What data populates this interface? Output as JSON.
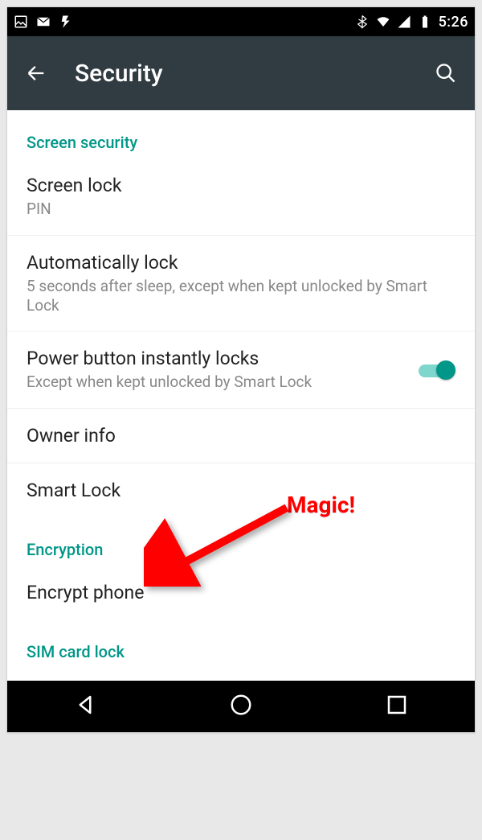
{
  "statusbar": {
    "time": "5:26"
  },
  "appbar": {
    "title": "Security"
  },
  "sections": {
    "screen_security": {
      "header": "Screen security",
      "screen_lock": {
        "title": "Screen lock",
        "value": "PIN"
      },
      "auto_lock": {
        "title": "Automatically lock",
        "value": "5 seconds after sleep, except when kept unlocked by Smart Lock"
      },
      "power_lock": {
        "title": "Power button instantly locks",
        "value": "Except when kept unlocked by Smart Lock",
        "toggle": true
      },
      "owner_info": {
        "title": "Owner info"
      },
      "smart_lock": {
        "title": "Smart Lock"
      }
    },
    "encryption": {
      "header": "Encryption",
      "encrypt_phone": {
        "title": "Encrypt phone"
      }
    },
    "sim": {
      "header": "SIM card lock"
    }
  },
  "annotation": {
    "label": "Magic!"
  },
  "colors": {
    "accent": "#009688"
  }
}
